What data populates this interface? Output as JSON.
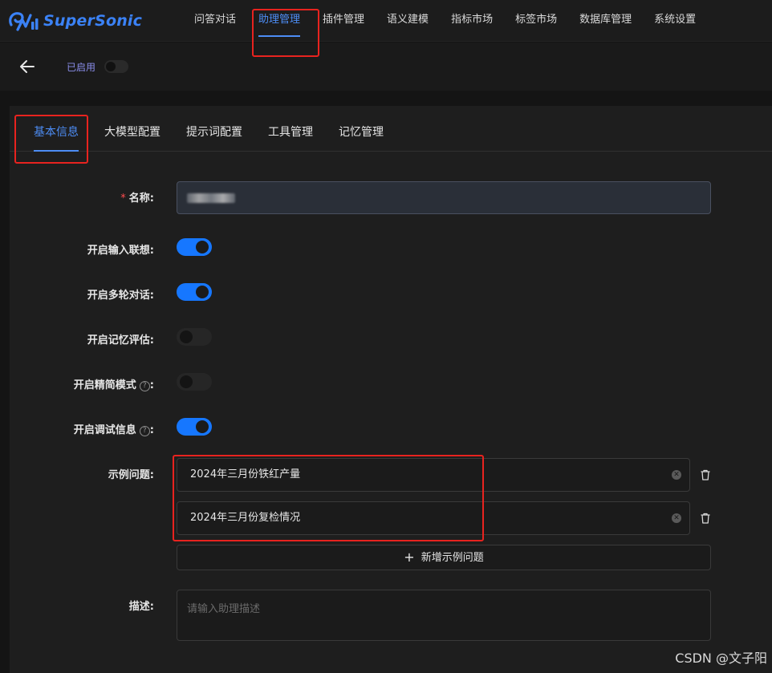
{
  "app": {
    "brand": "SuperSonic"
  },
  "nav": {
    "items": [
      {
        "label": "问答对话"
      },
      {
        "label": "助理管理"
      },
      {
        "label": "插件管理"
      },
      {
        "label": "语义建模"
      },
      {
        "label": "指标市场"
      },
      {
        "label": "标签市场"
      },
      {
        "label": "数据库管理"
      },
      {
        "label": "系统设置"
      }
    ],
    "active_label": "助理管理"
  },
  "header": {
    "status_label": "已启用",
    "status_enabled": false
  },
  "tabs": {
    "items": [
      {
        "label": "基本信息"
      },
      {
        "label": "大模型配置"
      },
      {
        "label": "提示词配置"
      },
      {
        "label": "工具管理"
      },
      {
        "label": "记忆管理"
      }
    ],
    "active_label": "基本信息"
  },
  "form": {
    "name_label": "名称:",
    "name_required_mark": "*",
    "input_assoc_label": "开启输入联想:",
    "input_assoc_on": true,
    "multi_turn_label": "开启多轮对话:",
    "multi_turn_on": true,
    "memory_eval_label": "开启记忆评估:",
    "memory_eval_on": false,
    "simple_mode_label": "开启精简模式",
    "simple_mode_on": false,
    "debug_info_label": "开启调试信息",
    "debug_info_on": true,
    "colon": ":",
    "help_glyph": "?",
    "examples_label": "示例问题:",
    "examples": [
      {
        "value": "2024年三月份铁红产量"
      },
      {
        "value": "2024年三月份复检情况"
      }
    ],
    "add_example_label": "新增示例问题",
    "description_label": "描述:",
    "description_placeholder": "请输入助理描述"
  },
  "watermark": "CSDN @文子阳",
  "colors": {
    "accent": "#4d8df5",
    "switch_on": "#1677ff",
    "highlight": "#e8231f",
    "required": "#ff4d4f"
  }
}
